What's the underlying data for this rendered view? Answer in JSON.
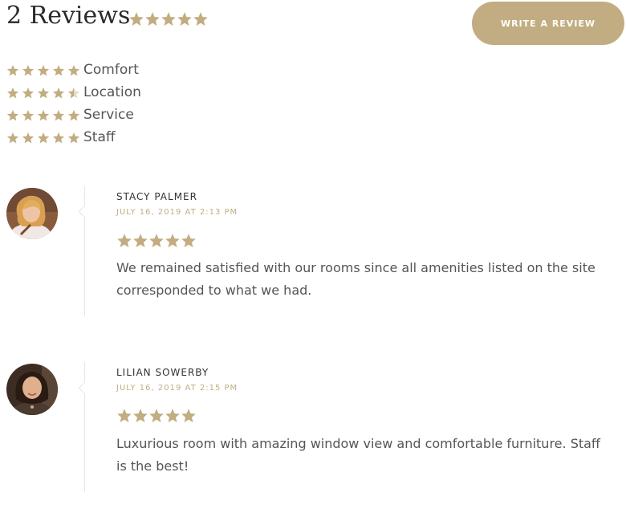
{
  "colors": {
    "accent": "#c2ad82",
    "star_empty": "#e3dac6",
    "text": "#555555",
    "heading": "#2a2a2a",
    "divider": "#e6e6e6"
  },
  "header": {
    "title": "2 Reviews",
    "overall_rating": 5,
    "write_review_label": "WRITE A REVIEW"
  },
  "categories": [
    {
      "label": "Comfort",
      "rating": 5
    },
    {
      "label": "Location",
      "rating": 4.5
    },
    {
      "label": "Service",
      "rating": 5
    },
    {
      "label": "Staff",
      "rating": 5
    }
  ],
  "reviews": [
    {
      "author": "STACY PALMER",
      "date": "JULY 16, 2019 AT 2:13 PM",
      "rating": 5,
      "text": "We remained satisfied with our rooms since all amenities listed on the site corresponded to what we had."
    },
    {
      "author": "LILIAN SOWERBY",
      "date": "JULY 16, 2019 AT 2:15 PM",
      "rating": 5,
      "text": "Luxurious room with amazing window view and comfortable furniture. Staff is the best!"
    }
  ]
}
